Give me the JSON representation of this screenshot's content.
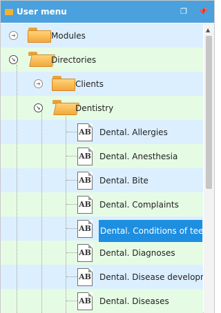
{
  "panel": {
    "title": "User menu",
    "restore_icon": "restore-window-icon",
    "pin_icon": "pin-icon"
  },
  "tree": {
    "nodes": [
      {
        "label": "Modules",
        "icon": "folder-icon",
        "expander": "collapsed"
      },
      {
        "label": "Directories",
        "icon": "open-folder-icon",
        "expander": "expanded"
      },
      {
        "label": "Clients",
        "icon": "folder-icon",
        "expander": "collapsed"
      },
      {
        "label": "Dentistry",
        "icon": "open-folder-icon",
        "expander": "expanded"
      },
      {
        "label": "Dental. Allergies",
        "icon": "ab-directory-icon"
      },
      {
        "label": "Dental. Anesthesia",
        "icon": "ab-directory-icon"
      },
      {
        "label": "Dental. Bite",
        "icon": "ab-directory-icon"
      },
      {
        "label": "Dental. Complaints",
        "icon": "ab-directory-icon"
      },
      {
        "label": "Dental. Conditions of teeth",
        "icon": "ab-directory-icon",
        "selected": true
      },
      {
        "label": "Dental. Diagnoses",
        "icon": "ab-directory-icon"
      },
      {
        "label": "Dental. Disease development",
        "icon": "ab-directory-icon"
      },
      {
        "label": "Dental. Diseases",
        "icon": "ab-directory-icon"
      }
    ],
    "item_icon_text": "AB"
  },
  "colors": {
    "titlebar": "#4aa1dd",
    "row_blue": "#dcefff",
    "row_green": "#e6fbe4",
    "selection": "#1e8ee0"
  }
}
